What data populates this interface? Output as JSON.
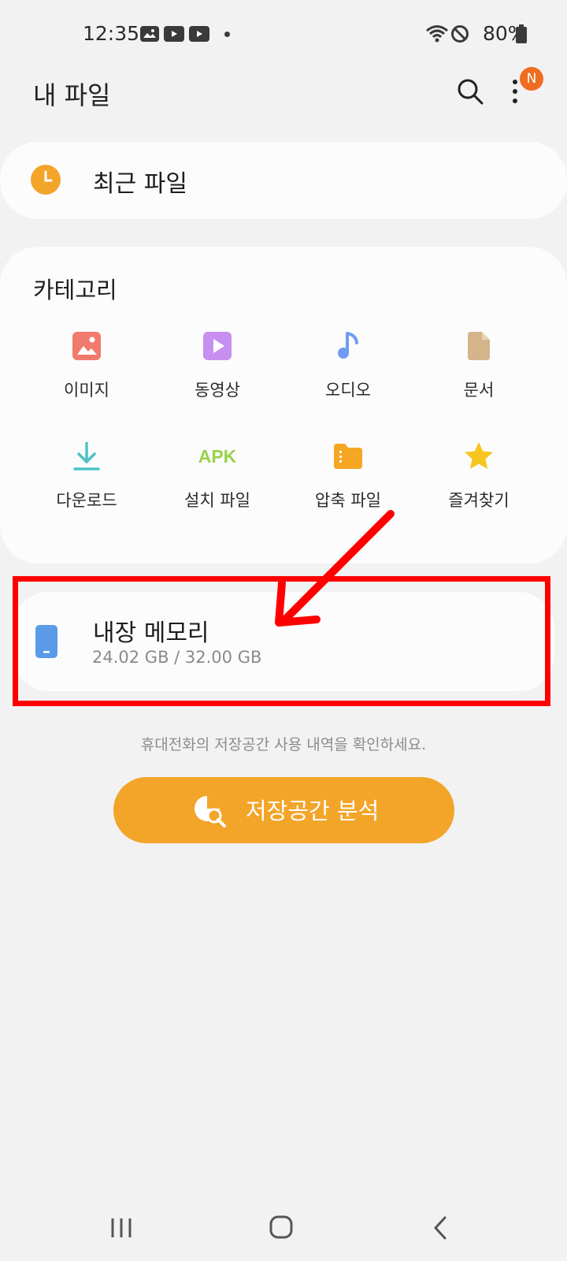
{
  "status_bar": {
    "time": "12:35",
    "battery": "80%"
  },
  "header": {
    "title": "내 파일",
    "badge": "N"
  },
  "recent": {
    "label": "최근 파일"
  },
  "categories": {
    "title": "카테고리",
    "items": [
      {
        "label": "이미지",
        "icon": "image-icon",
        "color": "#f07a6e"
      },
      {
        "label": "동영상",
        "icon": "video-icon",
        "color": "#c78ff0"
      },
      {
        "label": "오디오",
        "icon": "audio-icon",
        "color": "#6f9cf2"
      },
      {
        "label": "문서",
        "icon": "document-icon",
        "color": "#d4b48a"
      },
      {
        "label": "다운로드",
        "icon": "download-icon",
        "color": "#4cc3c3"
      },
      {
        "label": "설치 파일",
        "icon": "apk-icon",
        "color": "#9bd14a",
        "glyph": "APK"
      },
      {
        "label": "압축 파일",
        "icon": "zip-folder-icon",
        "color": "#f5a623"
      },
      {
        "label": "즐겨찾기",
        "icon": "star-icon",
        "color": "#f7c51e"
      }
    ]
  },
  "storage": {
    "title": "내장 메모리",
    "size": "24.02 GB / 32.00 GB"
  },
  "hint": "휴대전화의 저장공간 사용 내역을 확인하세요.",
  "analyze_button": {
    "label": "저장공간 분석"
  },
  "colors": {
    "accent": "#f3a529",
    "badge": "#ef6c21",
    "annotation": "#ff0000"
  }
}
